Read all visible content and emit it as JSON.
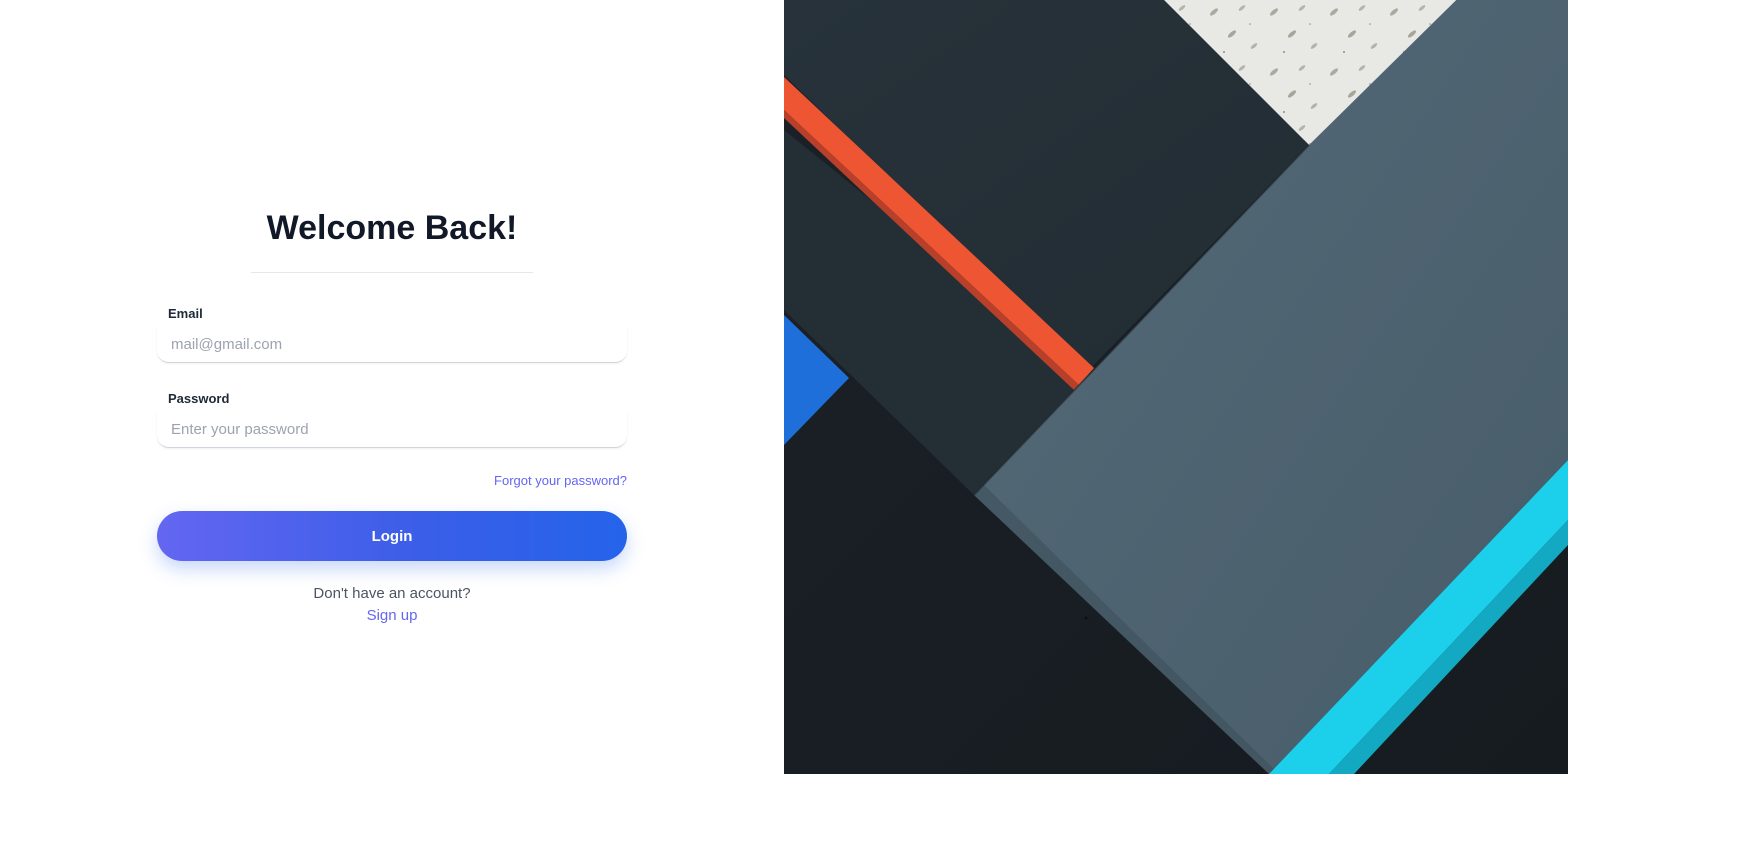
{
  "login_form": {
    "title": "Welcome Back!",
    "email": {
      "label": "Email",
      "placeholder": "mail@gmail.com",
      "value": ""
    },
    "password": {
      "label": "Password",
      "placeholder": "Enter your password",
      "value": ""
    },
    "forgot_password_link": "Forgot your password?",
    "login_button": "Login",
    "signup_prompt": "Don't have an account?",
    "signup_link": "Sign up"
  },
  "decorative_image": {
    "description_icon": "material-design-abstract-wallpaper"
  },
  "colors": {
    "title_text": "#111827",
    "accent_link": "#6366f1",
    "button_gradient_start": "#6366f1",
    "button_gradient_end": "#2563eb",
    "wallpaper_dark": "#1c2329",
    "wallpaper_slate": "#4f6472",
    "wallpaper_orange": "#ee5533",
    "wallpaper_cyan": "#1ccfea",
    "wallpaper_blue": "#1e6fd9"
  }
}
